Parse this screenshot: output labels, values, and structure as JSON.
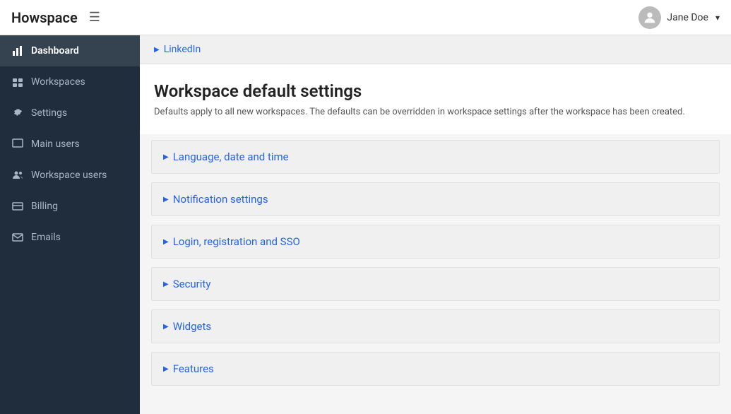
{
  "header": {
    "logo": "Howspace",
    "hamburger_label": "☰",
    "user_name": "Jane Doe",
    "dropdown_arrow": "▼"
  },
  "sidebar": {
    "items": [
      {
        "id": "dashboard",
        "label": "Dashboard",
        "active": true,
        "icon": "chart-icon"
      },
      {
        "id": "workspaces",
        "label": "Workspaces",
        "active": false,
        "icon": "workspaces-icon"
      },
      {
        "id": "settings",
        "label": "Settings",
        "active": false,
        "icon": "settings-icon"
      },
      {
        "id": "main-users",
        "label": "Main users",
        "active": false,
        "icon": "main-users-icon"
      },
      {
        "id": "workspace-users",
        "label": "Workspace users",
        "active": false,
        "icon": "workspace-users-icon"
      },
      {
        "id": "billing",
        "label": "Billing",
        "active": false,
        "icon": "billing-icon"
      },
      {
        "id": "emails",
        "label": "Emails",
        "active": false,
        "icon": "emails-icon"
      }
    ]
  },
  "content": {
    "linkedin_label": "LinkedIn",
    "page_title": "Workspace default settings",
    "page_description": "Defaults apply to all new workspaces. The defaults can be overridden in workspace settings after the workspace has been created.",
    "accordion_items": [
      {
        "id": "language",
        "label": "Language, date and time"
      },
      {
        "id": "notification",
        "label": "Notification settings"
      },
      {
        "id": "login",
        "label": "Login, registration and SSO"
      },
      {
        "id": "security",
        "label": "Security"
      },
      {
        "id": "widgets",
        "label": "Widgets"
      },
      {
        "id": "features",
        "label": "Features"
      }
    ]
  }
}
